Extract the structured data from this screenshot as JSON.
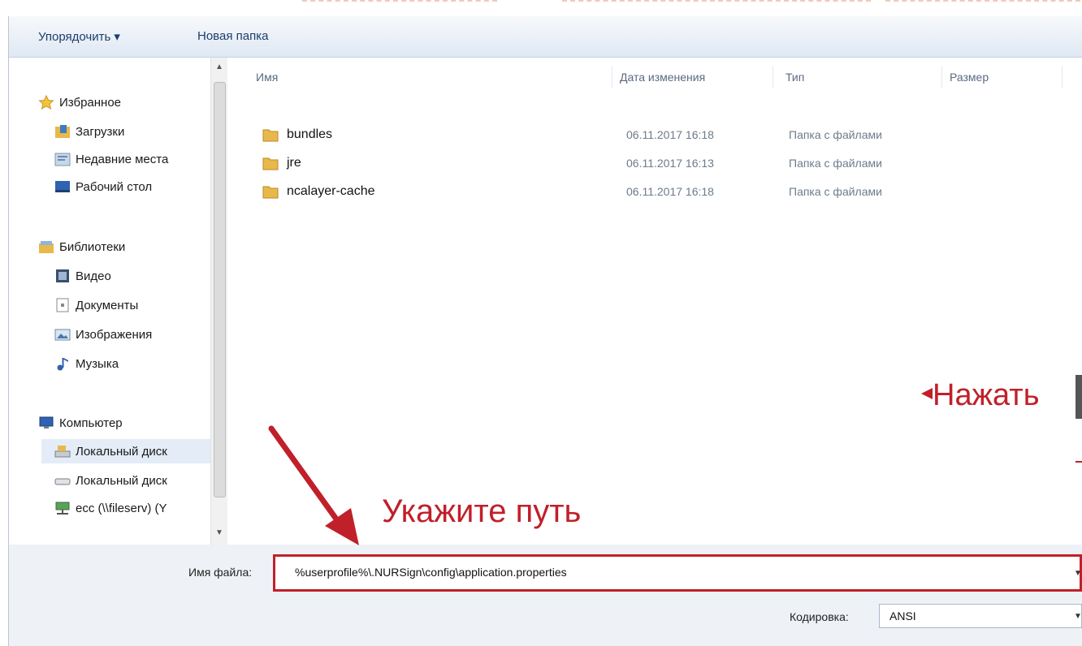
{
  "toolbar": {
    "organize_label": "Упорядочить ▾",
    "new_folder_label": "Новая папка"
  },
  "nav": {
    "favorites": {
      "label": "Избранное",
      "items": [
        {
          "label": "Загрузки"
        },
        {
          "label": "Недавние места"
        },
        {
          "label": "Рабочий стол"
        }
      ]
    },
    "libraries": {
      "label": "Библиотеки",
      "items": [
        {
          "label": "Видео"
        },
        {
          "label": "Документы"
        },
        {
          "label": "Изображения"
        },
        {
          "label": "Музыка"
        }
      ]
    },
    "computer": {
      "label": "Компьютер",
      "items": [
        {
          "label": "Локальный диск"
        },
        {
          "label": "Локальный диск"
        },
        {
          "label": "ecc (\\\\fileserv) (Y"
        }
      ]
    }
  },
  "columns": {
    "name": "Имя",
    "date": "Дата изменения",
    "type": "Тип",
    "size": "Размер"
  },
  "files": [
    {
      "name": "bundles",
      "date": "06.11.2017 16:18",
      "type": "Папка с файлами"
    },
    {
      "name": "jre",
      "date": "06.11.2017 16:13",
      "type": "Папка с файлами"
    },
    {
      "name": "ncalayer-cache",
      "date": "06.11.2017 16:18",
      "type": "Папка с файлами"
    }
  ],
  "filename": {
    "label": "Имя файла:",
    "value": "%userprofile%\\.NURSign\\config\\application.properties"
  },
  "encoding": {
    "label": "Кодировка:",
    "value": "ANSI"
  },
  "annotations": {
    "path_hint": "Укажите путь",
    "press_hint": "Нажать"
  },
  "colors": {
    "annotation": "#c0202a",
    "folder": "#e8b84a",
    "toolbar_text": "#1e3d6b"
  }
}
